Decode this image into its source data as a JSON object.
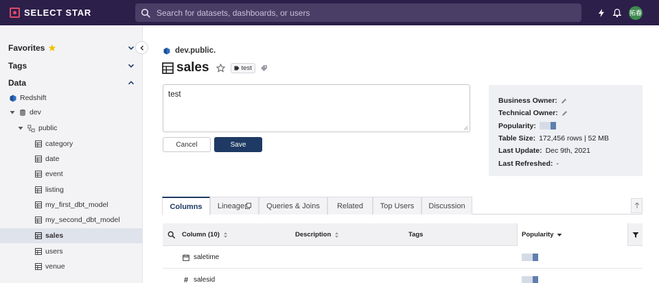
{
  "app": {
    "brand": "SELECT STAR"
  },
  "search": {
    "placeholder": "Search for datasets, dashboards, or users"
  },
  "user": {
    "initials": "拓春"
  },
  "sidebar": {
    "sections": {
      "favorites": "Favorites",
      "tags": "Tags",
      "data": "Data"
    },
    "tree": {
      "source": "Redshift",
      "database": "dev",
      "schema": "public",
      "tables": [
        "category",
        "date",
        "event",
        "listing",
        "my_first_dbt_model",
        "my_second_dbt_model",
        "sales",
        "users",
        "venue"
      ],
      "selected": "sales"
    }
  },
  "main": {
    "breadcrumb": "dev.public.",
    "title": "sales",
    "tag": "test",
    "description": "test",
    "buttons": {
      "cancel": "Cancel",
      "save": "Save"
    },
    "owners": {
      "business_owner_label": "Business Owner:",
      "technical_owner_label": "Technical Owner:",
      "popularity_label": "Popularity:",
      "table_size_label": "Table Size:",
      "table_size": "172,456 rows | 52 MB",
      "last_update_label": "Last Update:",
      "last_update": "Dec 9th, 2021",
      "last_refreshed_label": "Last Refreshed:",
      "last_refreshed": "-"
    },
    "tabs": [
      "Columns",
      "Lineage",
      "Queries & Joins",
      "Related",
      "Top Users",
      "Discussion"
    ],
    "table": {
      "headers": {
        "column": "Column (10)",
        "description": "Description",
        "tags": "Tags",
        "popularity": "Popularity"
      },
      "rows": [
        {
          "name": "saletime",
          "type_icon": "calendar-icon"
        },
        {
          "name": "salesid",
          "type_icon": "hash-icon"
        }
      ]
    }
  },
  "colors": {
    "nav": "#2c1f4a",
    "primary": "#1e3a64",
    "popularity_fill": "#5f7fae",
    "popularity_empty": "#d5dbe6"
  }
}
